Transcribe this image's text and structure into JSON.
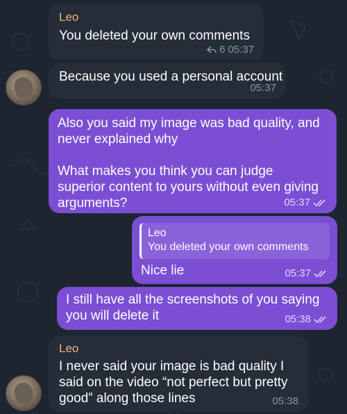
{
  "messages": [
    {
      "sender": "Leo",
      "text": "You deleted your own comments",
      "replies": "6",
      "time": "05:37"
    },
    {
      "text": "Because you used a personal account",
      "time": "05:37"
    },
    {
      "text": "Also you said my image was bad quality, and\nnever explained why\n\nWhat makes you think you can judge\nsuperior content to yours without even giving\narguments?",
      "time": "05:37"
    },
    {
      "quote_sender": "Leo",
      "quote_text": "You deleted your own comments",
      "text": "Nice lie",
      "time": "05:37"
    },
    {
      "text": "I still have all the screenshots of you saying\nyou will delete it",
      "time": "05:38"
    },
    {
      "sender": "Leo",
      "text": "I never said your image is bad quality I\nsaid on the video “not perfect but pretty\ngood” along those lines",
      "time": "05:38"
    }
  ],
  "colors": {
    "background": "#1c2530",
    "incoming": "#242d38",
    "outgoing": "#7b4ed3",
    "sender": "#f0b37e"
  },
  "icons": [
    "reply-arrow-icon",
    "double-check-icon",
    "avatar"
  ]
}
